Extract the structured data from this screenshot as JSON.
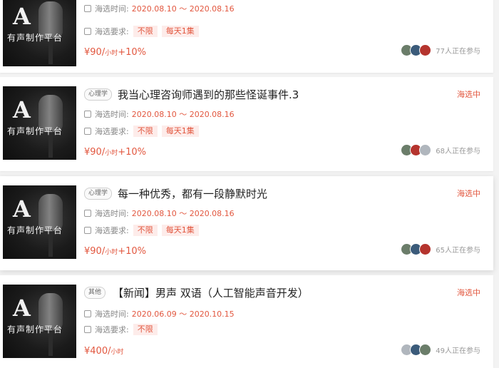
{
  "cards": [
    {
      "title": "",
      "category": "",
      "status": "",
      "thumb_text": "有声制作平台",
      "time_label": "海选时间:",
      "time_value": "2020.08.10 ～ 2020.08.16",
      "req_label": "海选要求:",
      "req_tags": [
        "不限",
        "每天1集"
      ],
      "price": "¥90/",
      "price_unit": "小时",
      "price_bonus": "+10%",
      "participants": "77人正在参与"
    },
    {
      "title": "我当心理咨询师遇到的那些怪诞事件.3",
      "category": "心理学",
      "status": "海选中",
      "thumb_text": "有声制作平台",
      "time_label": "海选时间:",
      "time_value": "2020.08.10 ～ 2020.08.16",
      "req_label": "海选要求:",
      "req_tags": [
        "不限",
        "每天1集"
      ],
      "price": "¥90/",
      "price_unit": "小时",
      "price_bonus": "+10%",
      "participants": "68人正在参与"
    },
    {
      "title": "每一种优秀，都有一段静默时光",
      "category": "心理学",
      "status": "海选中",
      "thumb_text": "有声制作平台",
      "time_label": "海选时间:",
      "time_value": "2020.08.10 ～ 2020.08.16",
      "req_label": "海选要求:",
      "req_tags": [
        "不限",
        "每天1集"
      ],
      "price": "¥90/",
      "price_unit": "小时",
      "price_bonus": "+10%",
      "participants": "65人正在参与"
    },
    {
      "title": "【新闻】男声 双语（人工智能声音开发）",
      "category": "其他",
      "status": "海选中",
      "thumb_text": "有声制作平台",
      "time_label": "海选时间:",
      "time_value": "2020.06.09 ～ 2020.10.15",
      "req_label": "海选要求:",
      "req_tags": [
        "不限"
      ],
      "price": "¥400/",
      "price_unit": "小时",
      "price_bonus": "",
      "participants": "49人正在参与"
    }
  ],
  "colors": {
    "accent": "#e2573f",
    "badge_bg": "#fdecea"
  }
}
